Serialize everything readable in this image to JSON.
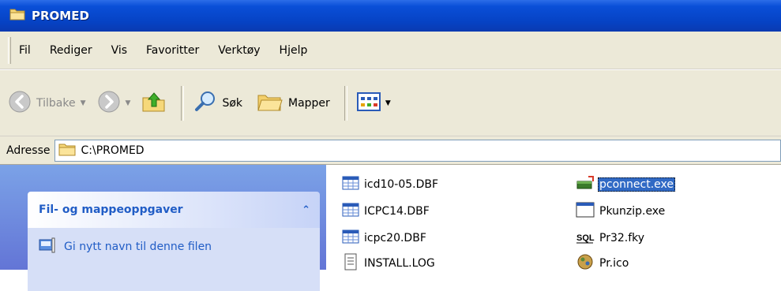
{
  "window": {
    "title": "PROMED"
  },
  "menu": {
    "items": [
      "Fil",
      "Rediger",
      "Vis",
      "Favoritter",
      "Verktøy",
      "Hjelp"
    ]
  },
  "toolbar": {
    "back": "Tilbake",
    "search": "Søk",
    "folders": "Mapper"
  },
  "address": {
    "label": "Adresse",
    "path": "C:\\PROMED"
  },
  "tasks": {
    "title": "Fil- og mappeoppgaver",
    "items": [
      "Gi nytt navn til denne filen"
    ]
  },
  "files": {
    "col1": [
      "icd10-05.DBF",
      "ICPC14.DBF",
      "icpc20.DBF",
      "INSTALL.LOG"
    ],
    "col2": [
      "pconnect.exe",
      "Pkunzip.exe",
      "Pr32.fky",
      "Pr.ico"
    ],
    "selected": "pconnect.exe"
  },
  "colors": {
    "title_bar": "#0a4fd8",
    "task_link": "#215dc6",
    "selection": "#316ac5"
  }
}
